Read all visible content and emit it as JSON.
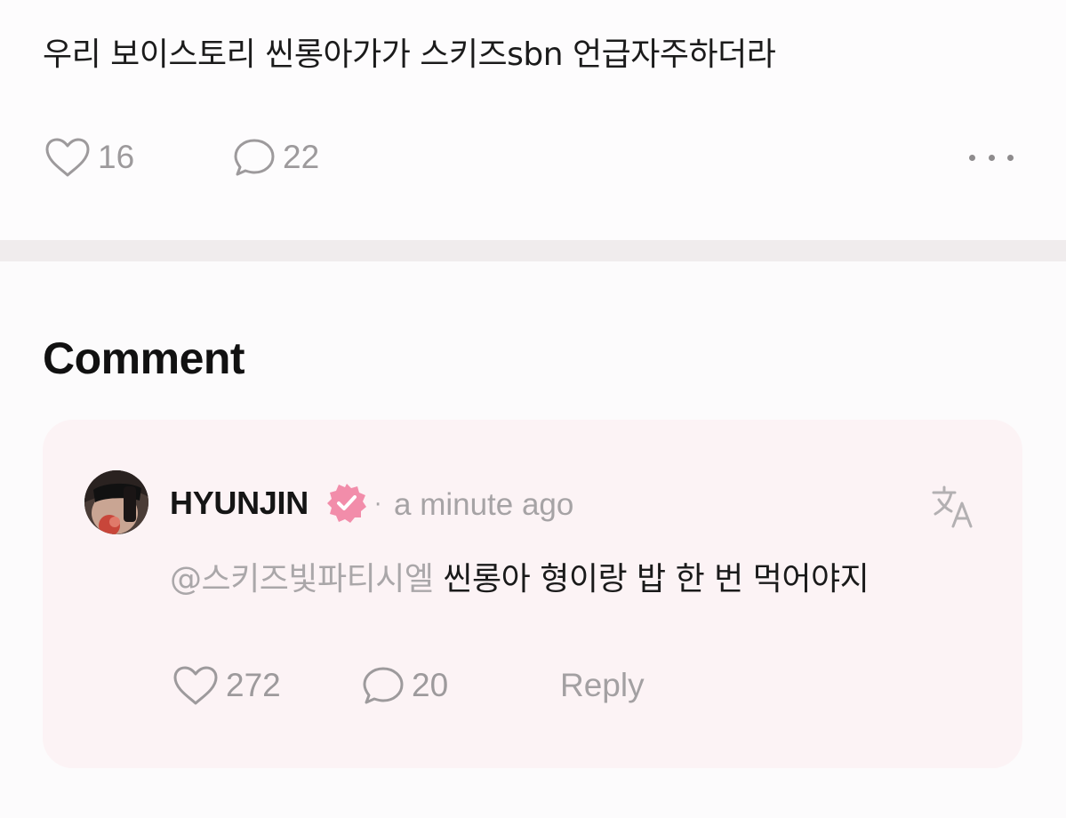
{
  "post": {
    "text": "우리 보이스토리 씬롱아가가 스키즈sbn 언급자주하더라",
    "like_count": "16",
    "comment_count": "22",
    "icons": {
      "like": "heart-outline-icon",
      "comment": "speech-bubble-icon",
      "more": "more-horizontal-icon"
    }
  },
  "comments_section": {
    "title": "Comment",
    "comments": [
      {
        "author": "HYUNJIN",
        "separator": "·",
        "timestamp": "a minute ago",
        "mention": "@스키즈빛파티시엘",
        "text": "씬롱아 형이랑 밥 한 번 먹어야지",
        "like_count": "272",
        "reply_count": "20",
        "reply_label": "Reply",
        "icons": {
          "verified": "verified-badge-icon",
          "translate": "translate-icon",
          "like": "heart-outline-icon",
          "comment": "speech-bubble-icon"
        }
      }
    ]
  },
  "colors": {
    "background": "#f7f5f6",
    "card_pink": "#fcf3f5",
    "verified_pink": "#f28daa",
    "muted_text": "#a6a3a5",
    "icon_gray": "#9d9a9c"
  }
}
